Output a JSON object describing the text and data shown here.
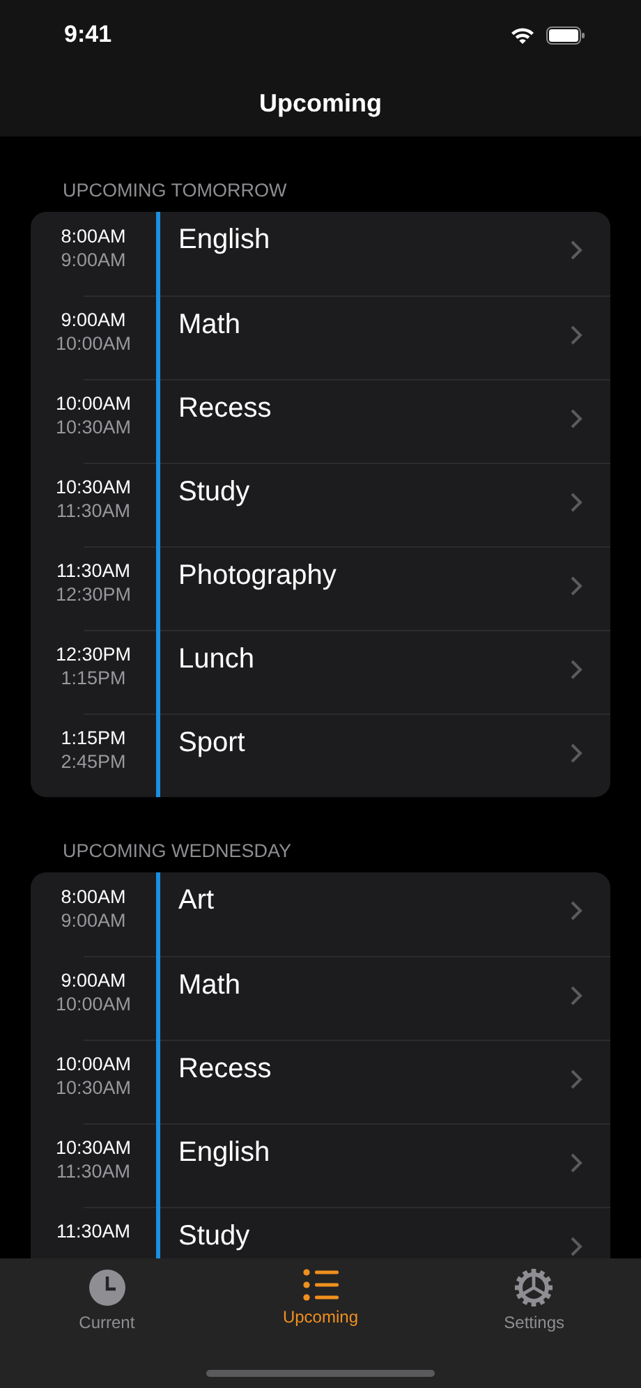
{
  "status_bar": {
    "time": "9:41"
  },
  "nav": {
    "title": "Upcoming"
  },
  "sections": [
    {
      "header": "UPCOMING TOMORROW",
      "rows": [
        {
          "start": "8:00AM",
          "end": "9:00AM",
          "title": "English"
        },
        {
          "start": "9:00AM",
          "end": "10:00AM",
          "title": "Math"
        },
        {
          "start": "10:00AM",
          "end": "10:30AM",
          "title": "Recess"
        },
        {
          "start": "10:30AM",
          "end": "11:30AM",
          "title": "Study"
        },
        {
          "start": "11:30AM",
          "end": "12:30PM",
          "title": "Photography"
        },
        {
          "start": "12:30PM",
          "end": "1:15PM",
          "title": "Lunch"
        },
        {
          "start": "1:15PM",
          "end": "2:45PM",
          "title": "Sport"
        }
      ]
    },
    {
      "header": "UPCOMING WEDNESDAY",
      "rows": [
        {
          "start": "8:00AM",
          "end": "9:00AM",
          "title": "Art"
        },
        {
          "start": "9:00AM",
          "end": "10:00AM",
          "title": "Math"
        },
        {
          "start": "10:00AM",
          "end": "10:30AM",
          "title": "Recess"
        },
        {
          "start": "10:30AM",
          "end": "11:30AM",
          "title": "English"
        },
        {
          "start": "11:30AM",
          "title": "Study"
        }
      ]
    }
  ],
  "tabs": [
    {
      "label": "Current",
      "kind": "clock",
      "selected": false
    },
    {
      "label": "Upcoming",
      "kind": "list",
      "selected": true
    },
    {
      "label": "Settings",
      "kind": "gear",
      "selected": false
    }
  ]
}
